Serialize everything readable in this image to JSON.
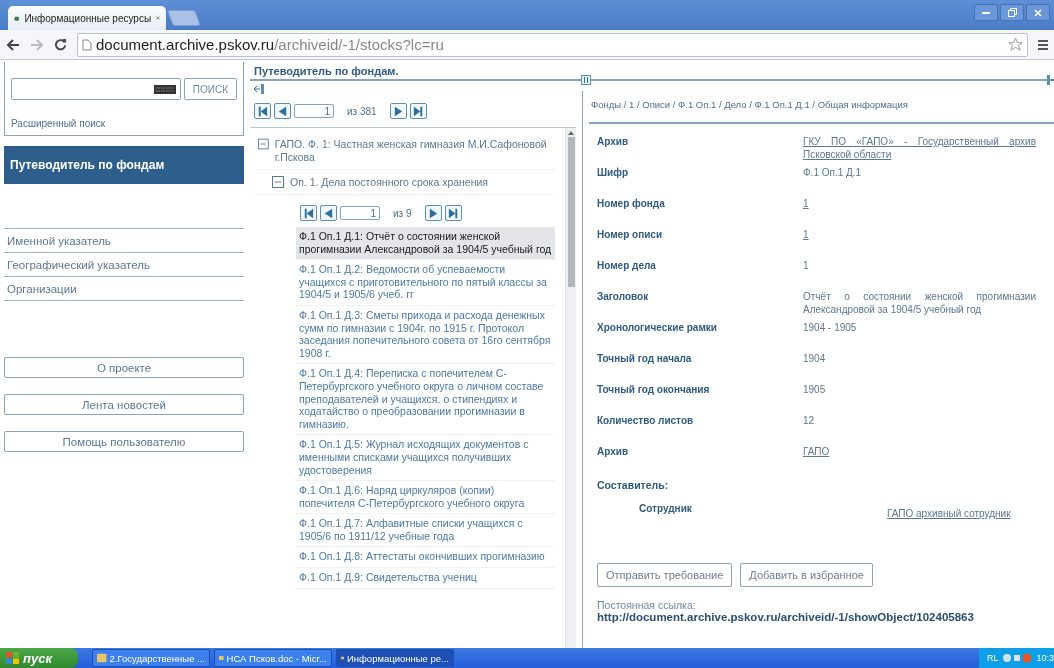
{
  "browser": {
    "tab_title": "Информационные ресурсы",
    "url_host": "document.archive.pskov.ru",
    "url_path": "/archiveid/-1/stocks?lc=ru"
  },
  "search": {
    "button": "ПОИСК",
    "advanced_link": "Расширенный поиск"
  },
  "nav": [
    {
      "label": "Путеводитель по фондам",
      "selected": true
    },
    {
      "label": "Именной указатель",
      "selected": false
    },
    {
      "label": "Географический указатель",
      "selected": false
    },
    {
      "label": "Организации",
      "selected": false
    }
  ],
  "side_buttons": [
    "О проекте",
    "Лента новостей",
    "Помощь пользователю"
  ],
  "guide": {
    "title": "Путеводитель по фондам.",
    "pager": {
      "page": "1",
      "total": "из 381"
    }
  },
  "tree": [
    {
      "label": "ГАПО. Ф. 1: Частная женская гимназия М.И.Сафоновой г.Пскова",
      "expanded": true,
      "children": [
        {
          "label": "Оп. 1. Дела постоянного срока хранения",
          "expanded": true,
          "pager": {
            "page": "1",
            "total": "из 9"
          },
          "items": [
            {
              "label": "Ф.1 Оп.1 Д.1: Отчёт о состоянии женской прогимназии Александровой за 1904/5 учебный год",
              "selected": true
            },
            {
              "label": "Ф.1 Оп.1 Д.2: Ведомости об успеваемости учащихся с приготовительного по пятый классы за 1904/5 и 1905/6 учеб. гг",
              "selected": false
            },
            {
              "label": "Ф.1 Оп.1 Д.3: Сметы прихода и расхода денежных сумм по гимназии с 1904г. по 1915 г. Протокол заседания попечительного совета от 16го сентября 1908 г.",
              "selected": false
            },
            {
              "label": "Ф.1 Оп.1 Д.4: Переписка с попечителем С-Петербургского учебного округа о личном составе преподавателей и учащихся. о стипендиях и ходатайство о преобразовании прогимназии в гимназию.",
              "selected": false
            },
            {
              "label": "Ф.1 Оп.1 Д.5: Журнал исходящих документов с именными списками учащихся получивших удостоверения",
              "selected": false
            },
            {
              "label": "Ф.1 Оп.1 Д.6: Наряд циркуляров (копии) попечителя С-Петербургского учебного округа",
              "selected": false
            },
            {
              "label": "Ф.1 Оп.1 Д.7: Алфавитные списки учащихся с 1905/6 по 1911/12 учебные года",
              "selected": false
            },
            {
              "label": "Ф.1 Оп.1 Д.8: Аттестаты окончивших прогимназию",
              "selected": false
            },
            {
              "label": "Ф.1 Оп.1 Д.9: Свидетельства учениц",
              "selected": false
            }
          ]
        }
      ]
    }
  ],
  "details": {
    "breadcrumb": "Фонды / 1 / Описи / Ф.1 Оп.1 / Дело / Ф.1 Оп.1 Д.1 / Общая информация",
    "fields": [
      {
        "label": "Архив",
        "value": "ГКУ ПО «ГАПО» - Государственный архив Псковской области",
        "kind": "link"
      },
      {
        "label": "Шифр",
        "value": "Ф.1 Оп.1 Д.1",
        "kind": "text"
      },
      {
        "label": "Номер фонда",
        "value": "1",
        "kind": "link"
      },
      {
        "label": "Номер описи",
        "value": "1",
        "kind": "link"
      },
      {
        "label": "Номер дела",
        "value": "1",
        "kind": "text"
      },
      {
        "label": "Заголовок",
        "value": "Отчёт о состоянии женской прогимназии Александровой за 1904/5 учебный год",
        "kind": "text"
      },
      {
        "label": "Хронологические рамки",
        "value": "1904 - 1905",
        "kind": "text"
      },
      {
        "label": "Точный год начала",
        "value": "1904",
        "kind": "text"
      },
      {
        "label": "Точный год окончания",
        "value": "1905",
        "kind": "text"
      },
      {
        "label": "Количество листов",
        "value": "12",
        "kind": "text"
      },
      {
        "label": "Архив",
        "value": "ГАПО",
        "kind": "link"
      }
    ],
    "compiler_heading": "Составитель:",
    "compiler": {
      "label": "Сотрудник",
      "value": "ГАПО архивный сотрудник"
    },
    "buttons": [
      "Отправить требование",
      "Добавить в избранное"
    ],
    "permalink_label": "Постоянная ссылка:",
    "permalink": "http://document.archive.pskov.ru/archiveid/-1/showObject/102405863"
  },
  "taskbar": {
    "start": "пуск",
    "tasks": [
      {
        "label": "2.Государственные ...",
        "selected": false
      },
      {
        "label": "НСА Псков.doc - Micr...",
        "selected": false
      },
      {
        "label": "Информационные ре...",
        "selected": true
      }
    ],
    "lang": "RL",
    "clock": "10:3"
  }
}
